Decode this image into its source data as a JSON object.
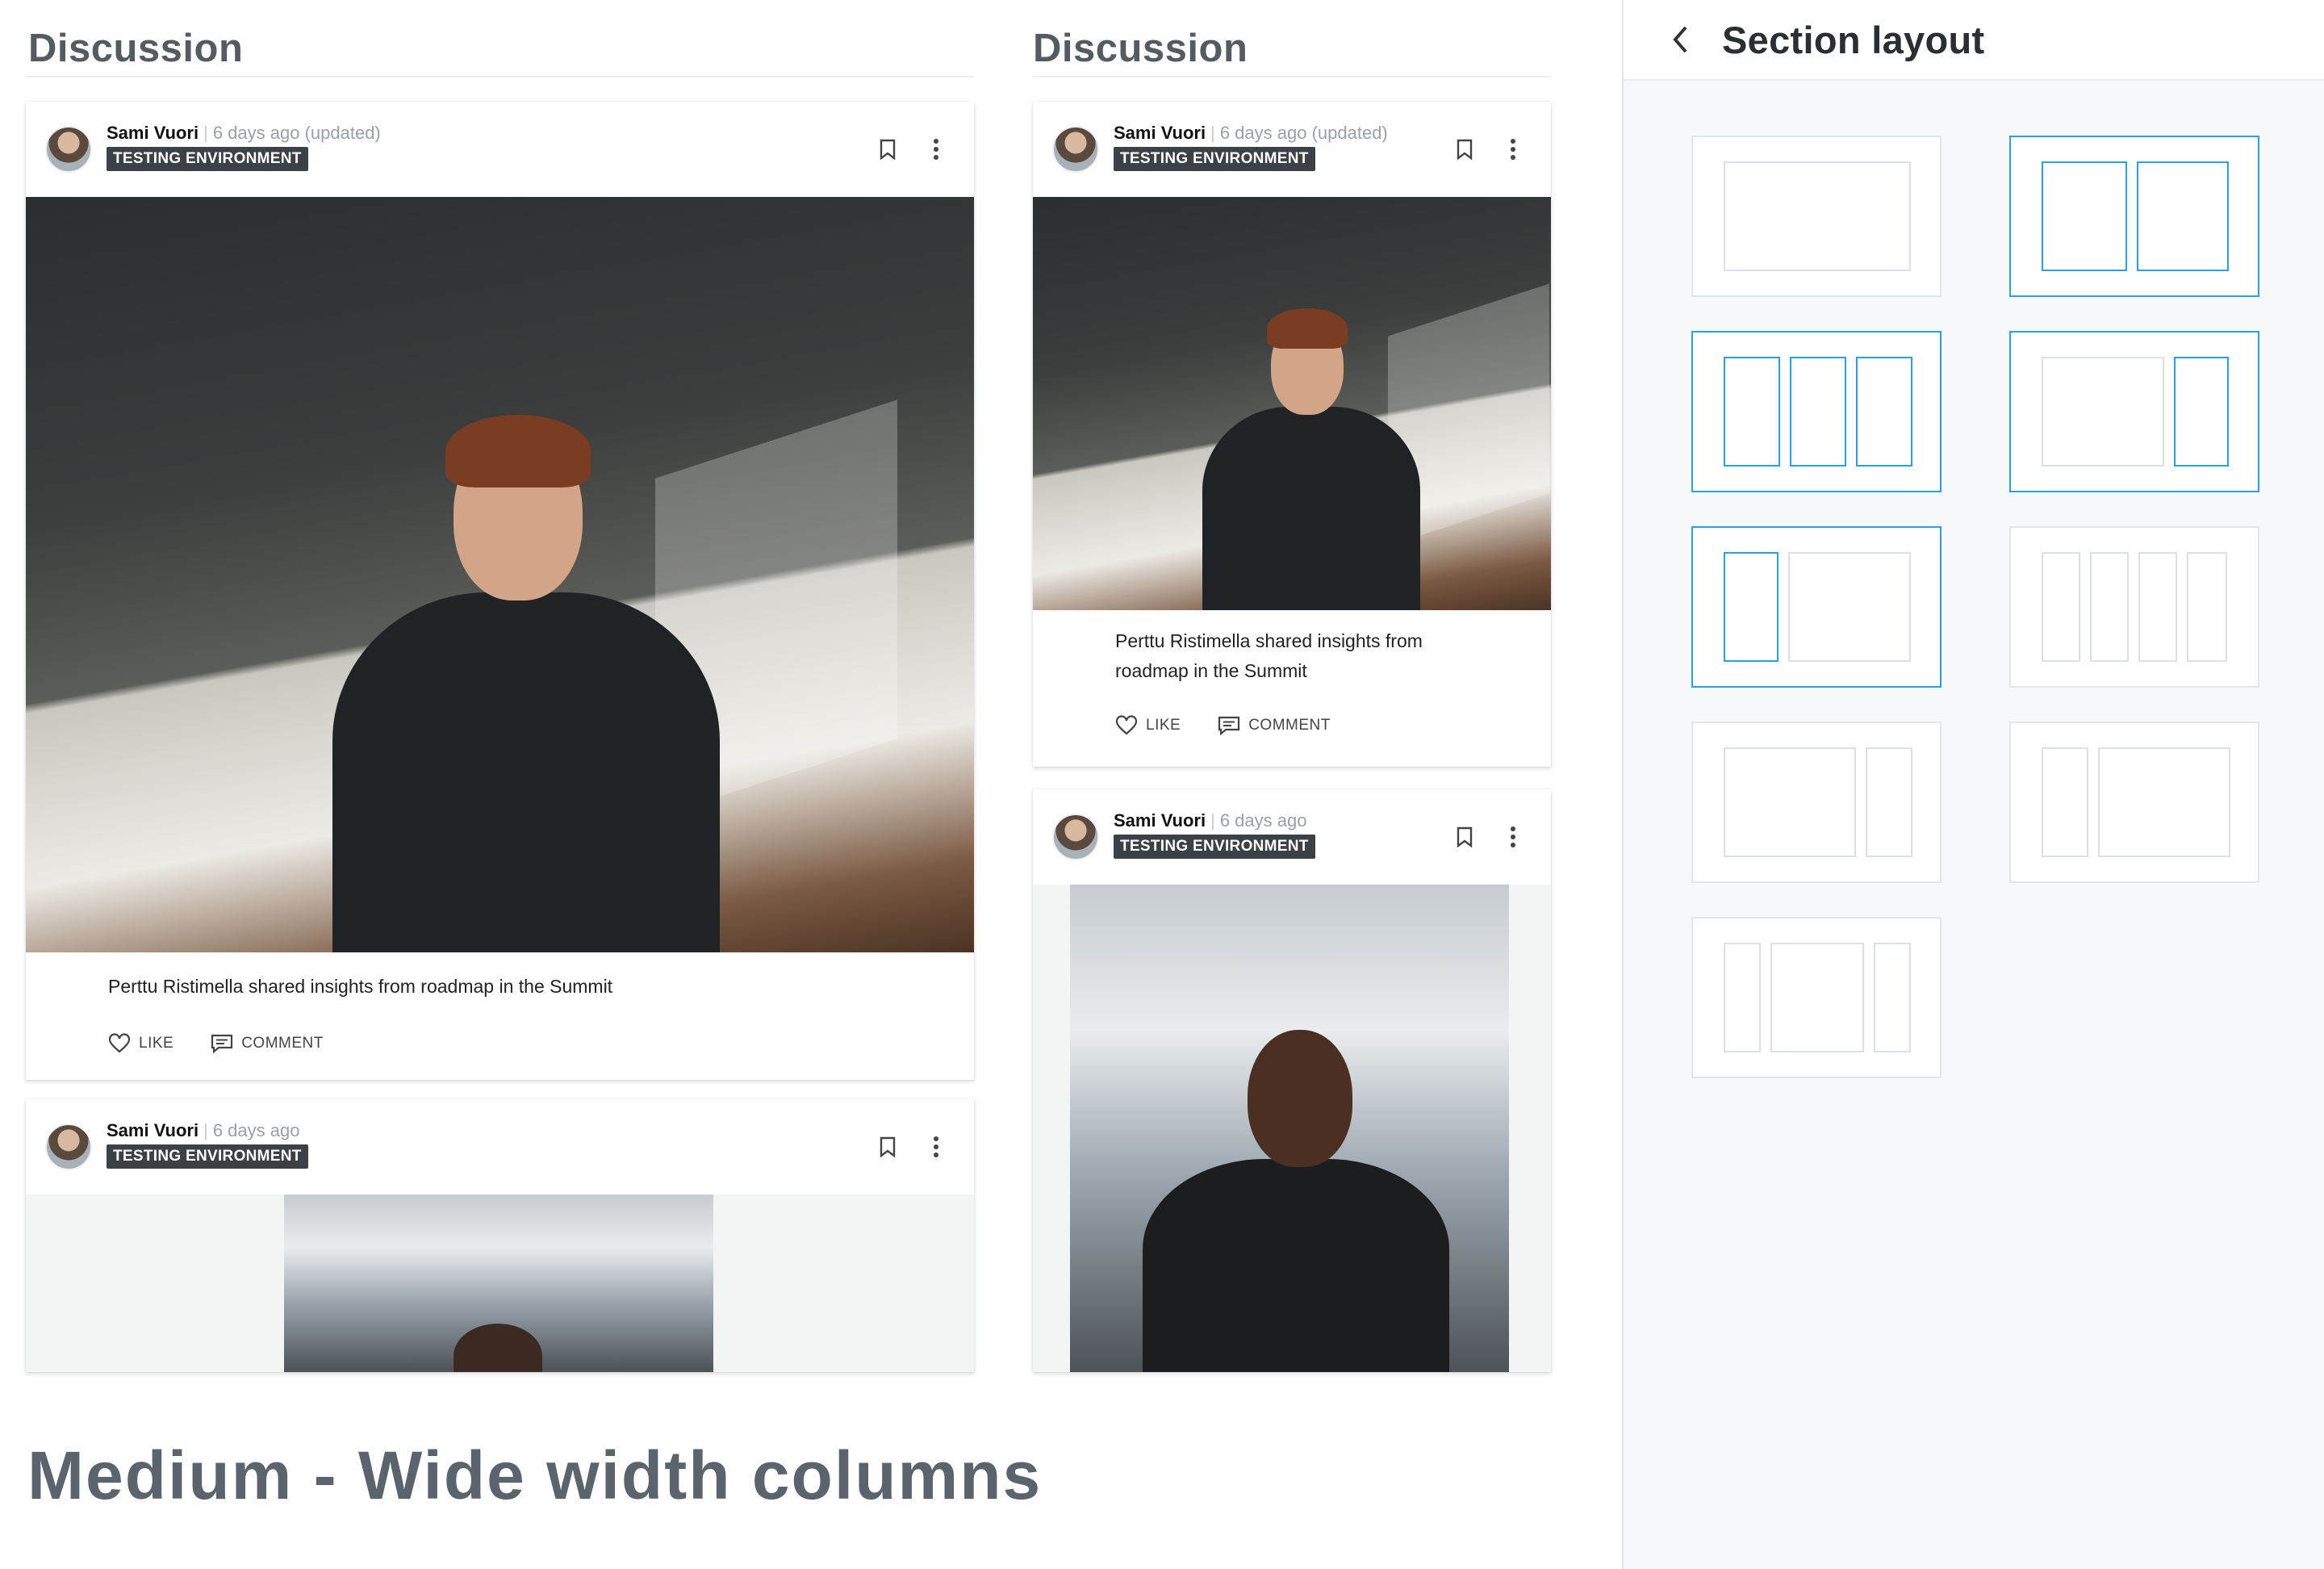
{
  "left": {
    "section_title": "Discussion",
    "posts": [
      {
        "author": "Sami Vuori",
        "time": "6 days ago (updated)",
        "badge": "TESTING ENVIRONMENT",
        "text": "Perttu Ristimella shared insights from roadmap in the Summit",
        "like_label": "LIKE",
        "comment_label": "COMMENT"
      },
      {
        "author": "Sami Vuori",
        "time": "6 days ago",
        "badge": "TESTING ENVIRONMENT"
      }
    ]
  },
  "right_column": {
    "section_title": "Discussion",
    "posts": [
      {
        "author": "Sami Vuori",
        "time": "6 days ago (updated)",
        "badge": "TESTING ENVIRONMENT",
        "text": "Perttu Ristimella shared insights from roadmap in the Summit",
        "like_label": "LIKE",
        "comment_label": "COMMENT"
      },
      {
        "author": "Sami Vuori",
        "time": "6 days ago",
        "badge": "TESTING ENVIRONMENT"
      }
    ]
  },
  "caption": "Medium - Wide width columns",
  "panel": {
    "title": "Section layout",
    "accent_color": "#29a1e6",
    "options": [
      {
        "layout": "single-column",
        "selected": false
      },
      {
        "layout": "two-equal-columns",
        "selected": true
      },
      {
        "layout": "three-equal-columns",
        "selected": true
      },
      {
        "layout": "wide-left-narrow-right",
        "selected": true
      },
      {
        "layout": "narrow-left-wide-right",
        "selected": true
      },
      {
        "layout": "four-equal-columns",
        "selected": false
      },
      {
        "layout": "wide-left-narrow-right-alt",
        "selected": false
      },
      {
        "layout": "narrow-left-wide-right-alt",
        "selected": false
      },
      {
        "layout": "narrow-wide-narrow",
        "selected": false
      }
    ]
  }
}
